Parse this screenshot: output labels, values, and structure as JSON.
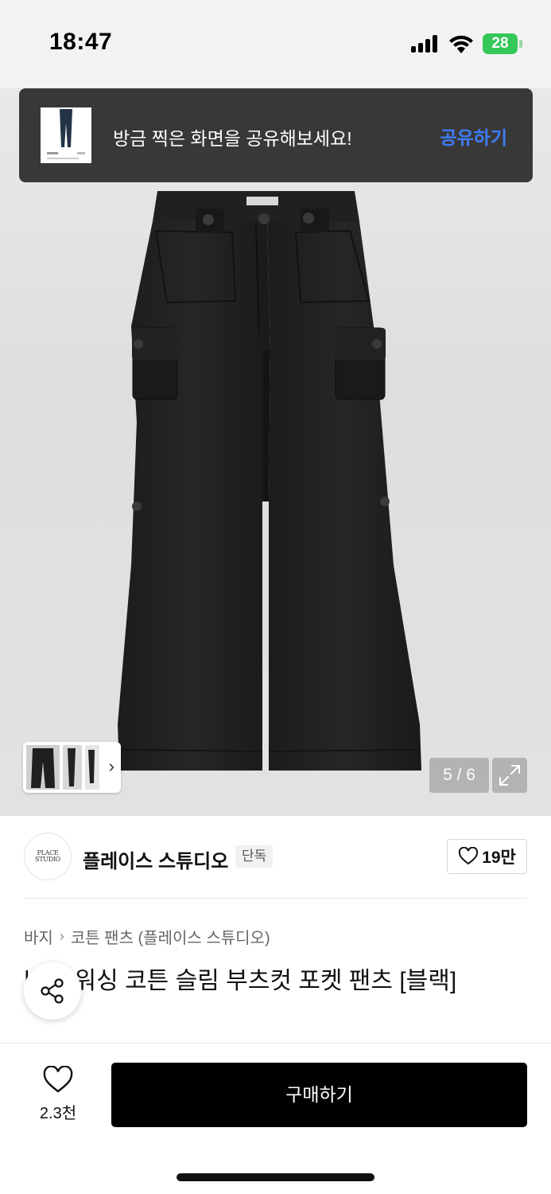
{
  "status_bar": {
    "time": "18:47",
    "battery": "28"
  },
  "share_toast": {
    "message": "방금 찍은 화면을 공유해보세요!",
    "action": "공유하기"
  },
  "gallery": {
    "counter": "5 / 6"
  },
  "brand": {
    "name": "플레이스 스튜디오",
    "badge": "단독",
    "likes": "19만",
    "logo_text": "PLACE STUDIO"
  },
  "breadcrumb": {
    "category": "바지",
    "separator": "›",
    "subcategory": "코튼 팬츠 (플레이스 스튜디오)"
  },
  "product": {
    "title": "버튼 워싱 코튼 슬림 부츠컷 포켓 팬츠 [블랙]"
  },
  "bottom_bar": {
    "wish_count": "2.3천",
    "buy_label": "구매하기"
  },
  "colors": {
    "toast_bg": "#383838",
    "toast_action": "#3f7cf5",
    "buy_button": "#000000",
    "battery": "#34c759"
  }
}
